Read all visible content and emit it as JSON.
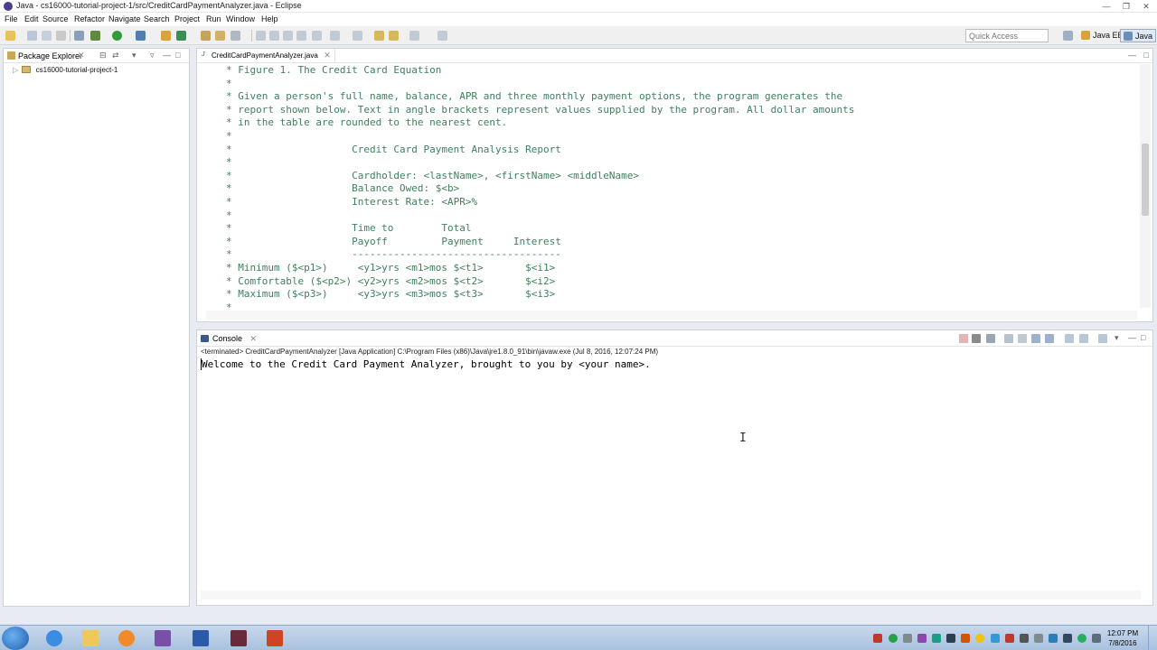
{
  "window": {
    "title": "Java - cs16000-tutorial-project-1/src/CreditCardPaymentAnalyzer.java - Eclipse"
  },
  "menu": [
    "File",
    "Edit",
    "Source",
    "Refactor",
    "Navigate",
    "Search",
    "Project",
    "Run",
    "Window",
    "Help"
  ],
  "toolbar": {
    "quick_access_placeholder": "Quick Access",
    "perspectives": [
      "Java EE",
      "Java"
    ]
  },
  "package_explorer": {
    "title": "Package Explorer",
    "project": "cs16000-tutorial-project-1"
  },
  "editor": {
    "tab": "CreditCardPaymentAnalyzer.java",
    "lines": [
      "* Figure 1. The Credit Card Equation",
      "*",
      "* Given a person's full name, balance, APR and three monthly payment options, the program generates the",
      "* report shown below. Text in angle brackets represent values supplied by the program. All dollar amounts",
      "* in the table are rounded to the nearest cent.",
      "*",
      "*                    Credit Card Payment Analysis Report",
      "*",
      "*                    Cardholder: <lastName>, <firstName> <middleName>",
      "*                    Balance Owed: $<b>",
      "*                    Interest Rate: <APR>%",
      "*",
      "*                    Time to        Total",
      "*                    Payoff         Payment     Interest",
      "*                    -----------------------------------",
      "* Minimum ($<p1>)     <y1>yrs <m1>mos $<t1>       $<i1>",
      "* Comfortable ($<p2>) <y2>yrs <m2>mos $<t2>       $<i2>",
      "* Maximum ($<p3>)     <y3>yrs <m3>mos $<t3>       $<i3>",
      "*"
    ]
  },
  "console": {
    "title": "Console",
    "terminated": "<terminated> CreditCardPaymentAnalyzer [Java Application] C:\\Program Files (x86)\\Java\\jre1.8.0_91\\bin\\javaw.exe (Jul 8, 2016, 12:07:24 PM)",
    "output": "Welcome to the Credit Card Payment Analyzer, brought to you by <your name>."
  },
  "taskbar": {
    "apps": [
      "internet-explorer",
      "file-explorer",
      "media-player",
      "visual-studio",
      "word",
      "winrar",
      "powerpoint"
    ],
    "clock_time": "12:07 PM",
    "clock_date": "7/8/2016"
  },
  "colors": {
    "comment_green": "#3f7f5f",
    "accent_blue": "#1c5a9e",
    "taskbar": "#b4c9e3"
  }
}
